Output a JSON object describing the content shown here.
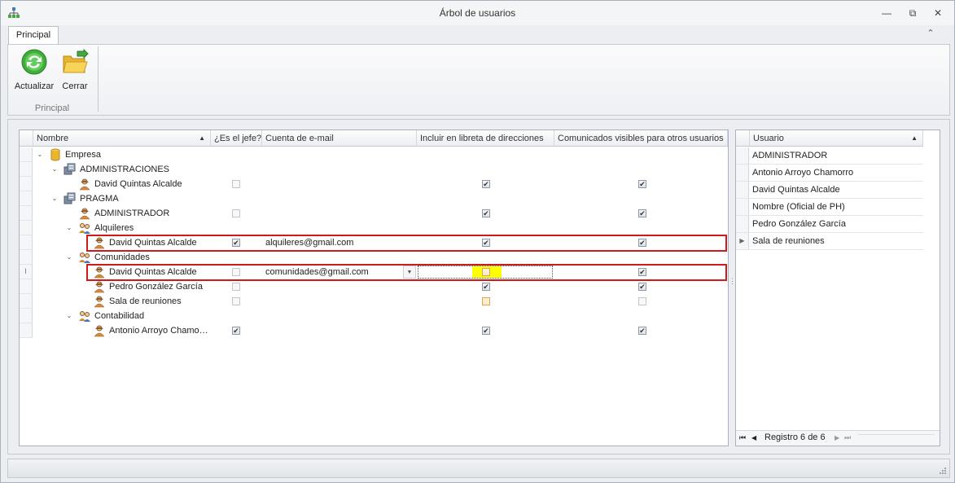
{
  "window": {
    "title": "Árbol de usuarios",
    "controls": {
      "minimize": "—",
      "restore": "⧉",
      "close": "✕"
    }
  },
  "ribbon": {
    "tab": "Principal",
    "collapse_glyph": "⌃",
    "buttons": [
      {
        "label": "Actualizar",
        "icon": "refresh-icon"
      },
      {
        "label": "Cerrar",
        "icon": "folder-close-icon"
      }
    ],
    "group_label": "Principal"
  },
  "tree_grid": {
    "columns": [
      "Nombre",
      "¿Es el jefe?",
      "Cuenta de e-mail",
      "Incluir en libreta de direcciones",
      "Comunicados visibles para otros usuarios"
    ],
    "sort_glyph": "▲",
    "rows": [
      {
        "name": "Empresa",
        "level": 0,
        "icon": "database-icon",
        "expanded": true,
        "boss": null,
        "email": "",
        "addressbook": null,
        "visible": null
      },
      {
        "name": "ADMINISTRACIONES",
        "level": 1,
        "icon": "server-group-icon",
        "expanded": true,
        "boss": null,
        "email": "",
        "addressbook": null,
        "visible": null
      },
      {
        "name": "David Quintas Alcalde",
        "level": 2,
        "icon": "user-icon",
        "boss": "off-dis",
        "email": "",
        "addressbook": "on",
        "visible": "on"
      },
      {
        "name": "PRAGMA",
        "level": 1,
        "icon": "server-group-icon",
        "expanded": true,
        "boss": null,
        "email": "",
        "addressbook": null,
        "visible": null
      },
      {
        "name": "ADMINISTRADOR",
        "level": 2,
        "icon": "user-icon",
        "boss": "off-dis",
        "email": "",
        "addressbook": "on",
        "visible": "on"
      },
      {
        "name": "Alquileres",
        "level": 2,
        "icon": "users-group-icon",
        "expanded": true,
        "boss": null,
        "email": "",
        "addressbook": null,
        "visible": null
      },
      {
        "name": "David Quintas Alcalde",
        "level": 3,
        "icon": "user-icon",
        "boss": "on",
        "email": "alquileres@gmail.com",
        "addressbook": "on",
        "visible": "on"
      },
      {
        "name": "Comunidades",
        "level": 2,
        "icon": "users-group-icon",
        "expanded": true,
        "boss": null,
        "email": "",
        "addressbook": null,
        "visible": null
      },
      {
        "name": "David Quintas Alcalde",
        "level": 3,
        "icon": "user-icon",
        "boss": "off-dis",
        "email": "comunidades@gmail.com",
        "addressbook": "orange-focus",
        "visible": "on",
        "editing": true
      },
      {
        "name": "Pedro González García",
        "level": 3,
        "icon": "user-icon",
        "boss": "off-dis",
        "email": "",
        "addressbook": "on",
        "visible": "on"
      },
      {
        "name": "Sala de reuniones",
        "level": 3,
        "icon": "user-icon",
        "boss": "off-dis",
        "email": "",
        "addressbook": "orange",
        "visible": "off-dis"
      },
      {
        "name": "Contabilidad",
        "level": 2,
        "icon": "users-group-icon",
        "expanded": true,
        "boss": null,
        "email": "",
        "addressbook": null,
        "visible": null
      },
      {
        "name": "Antonio Arroyo Chamo…",
        "level": 3,
        "icon": "user-icon",
        "boss": "on",
        "email": "",
        "addressbook": "on",
        "visible": "on"
      }
    ],
    "editing_row_indicator": "I"
  },
  "user_list": {
    "column": "Usuario",
    "sort_glyph": "▲",
    "items": [
      "ADMINISTRADOR",
      "Antonio Arroyo Chamorro",
      "David Quintas Alcalde",
      "Nombre (Oficial de PH)",
      "Pedro González García",
      "Sala de reuniones"
    ],
    "current_indicator": "▶",
    "navigator": {
      "record_text": "Registro 6 de 6",
      "first": "⏮",
      "prev": "◀",
      "next": "▶",
      "last": "⏭"
    }
  },
  "colors": {
    "highlight": "#d01a1a",
    "focus_fill": "#ffff00"
  }
}
